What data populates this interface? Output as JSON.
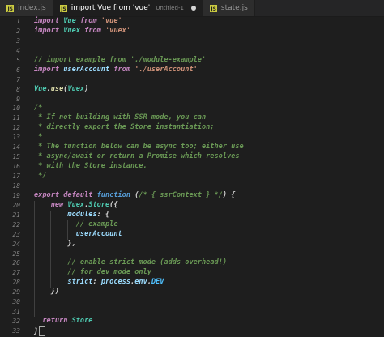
{
  "tabs": [
    {
      "name": "index.js",
      "active": false,
      "dirty": false,
      "subtitle": ""
    },
    {
      "name": "import Vue from 'vue'",
      "active": true,
      "dirty": true,
      "subtitle": "Untitled-1"
    },
    {
      "name": "state.js",
      "active": false,
      "dirty": false,
      "subtitle": ""
    }
  ],
  "colors": {
    "keyword": "#c586c0",
    "class": "#4ec9b0",
    "string": "#ce9178",
    "comment": "#6a9955",
    "function": "#dcdcaa",
    "variable": "#9cdcfe",
    "constant": "#4fc1ff",
    "punctuation": "#d4d4d4",
    "storage": "#569cd6"
  },
  "editor": {
    "lines": [
      {
        "n": "1",
        "tokens": [
          [
            "import ",
            "kw"
          ],
          [
            "Vue ",
            "cls"
          ],
          [
            "from ",
            "kw"
          ],
          [
            "'vue'",
            "str"
          ]
        ]
      },
      {
        "n": "2",
        "tokens": [
          [
            "import ",
            "kw"
          ],
          [
            "Vuex ",
            "cls"
          ],
          [
            "from ",
            "kw"
          ],
          [
            "'vuex'",
            "str"
          ]
        ]
      },
      {
        "n": "3",
        "tokens": []
      },
      {
        "n": "4",
        "tokens": []
      },
      {
        "n": "5",
        "tokens": [
          [
            "// import example from './module-example'",
            "cmt"
          ]
        ]
      },
      {
        "n": "6",
        "tokens": [
          [
            "import ",
            "kw"
          ],
          [
            "userAccount ",
            "var"
          ],
          [
            "from ",
            "kw"
          ],
          [
            "'./userAccount'",
            "str"
          ]
        ]
      },
      {
        "n": "7",
        "tokens": []
      },
      {
        "n": "8",
        "tokens": [
          [
            "Vue",
            "cls"
          ],
          [
            ".",
            "pn"
          ],
          [
            "use",
            "fn"
          ],
          [
            "(",
            "pn"
          ],
          [
            "Vuex",
            "cls"
          ],
          [
            ")",
            "pn"
          ]
        ]
      },
      {
        "n": "9",
        "tokens": []
      },
      {
        "n": "10",
        "tokens": [
          [
            "/*",
            "cmt"
          ]
        ]
      },
      {
        "n": "11",
        "tokens": [
          [
            " * If not building with SSR mode, you can",
            "cmt"
          ]
        ]
      },
      {
        "n": "12",
        "tokens": [
          [
            " * directly export the Store instantiation;",
            "cmt"
          ]
        ]
      },
      {
        "n": "13",
        "tokens": [
          [
            " *",
            "cmt"
          ]
        ]
      },
      {
        "n": "14",
        "tokens": [
          [
            " * The function below can be async too; either use",
            "cmt"
          ]
        ]
      },
      {
        "n": "15",
        "tokens": [
          [
            " * async/await or return a Promise which resolves",
            "cmt"
          ]
        ]
      },
      {
        "n": "16",
        "tokens": [
          [
            " * with the Store instance.",
            "cmt"
          ]
        ]
      },
      {
        "n": "17",
        "tokens": [
          [
            " */",
            "cmt"
          ]
        ]
      },
      {
        "n": "18",
        "tokens": []
      },
      {
        "n": "19",
        "tokens": [
          [
            "export ",
            "kw"
          ],
          [
            "default ",
            "kw"
          ],
          [
            "function ",
            "st"
          ],
          [
            "(",
            "pn"
          ],
          [
            "/* { ssrContext } */",
            "cmt"
          ],
          [
            ") {",
            "pn"
          ]
        ]
      },
      {
        "n": "20",
        "tokens": [
          [
            "    ",
            "pn"
          ],
          [
            "new ",
            "kw"
          ],
          [
            "Vuex",
            "cls"
          ],
          [
            ".",
            "pn"
          ],
          [
            "Store",
            "cls"
          ],
          [
            "({",
            "pn"
          ]
        ]
      },
      {
        "n": "21",
        "tokens": [
          [
            "        ",
            "pn"
          ],
          [
            "modules",
            "var"
          ],
          [
            ": {",
            "pn"
          ]
        ]
      },
      {
        "n": "22",
        "tokens": [
          [
            "          ",
            "pn"
          ],
          [
            "// example",
            "cmt"
          ]
        ]
      },
      {
        "n": "23",
        "tokens": [
          [
            "          ",
            "pn"
          ],
          [
            "userAccount",
            "var"
          ]
        ]
      },
      {
        "n": "24",
        "tokens": [
          [
            "        ",
            "pn"
          ],
          [
            "},",
            "pn"
          ]
        ]
      },
      {
        "n": "25",
        "tokens": []
      },
      {
        "n": "26",
        "tokens": [
          [
            "        ",
            "pn"
          ],
          [
            "// enable strict mode (adds overhead!)",
            "cmt"
          ]
        ]
      },
      {
        "n": "27",
        "tokens": [
          [
            "        ",
            "pn"
          ],
          [
            "// for dev mode only",
            "cmt"
          ]
        ]
      },
      {
        "n": "28",
        "tokens": [
          [
            "        ",
            "pn"
          ],
          [
            "strict",
            "var"
          ],
          [
            ": ",
            "pn"
          ],
          [
            "process",
            "var"
          ],
          [
            ".",
            "pn"
          ],
          [
            "env",
            "var"
          ],
          [
            ".",
            "pn"
          ],
          [
            "DEV",
            "con"
          ]
        ]
      },
      {
        "n": "29",
        "tokens": [
          [
            "    ",
            "pn"
          ],
          [
            "})",
            "pn"
          ]
        ]
      },
      {
        "n": "30",
        "tokens": []
      },
      {
        "n": "31",
        "tokens": []
      },
      {
        "n": "32",
        "tokens": [
          [
            "  ",
            "pn"
          ],
          [
            "return ",
            "kw"
          ],
          [
            "Store",
            "cls"
          ]
        ]
      },
      {
        "n": "33",
        "tokens": [
          [
            "}",
            "pn"
          ]
        ]
      }
    ]
  }
}
